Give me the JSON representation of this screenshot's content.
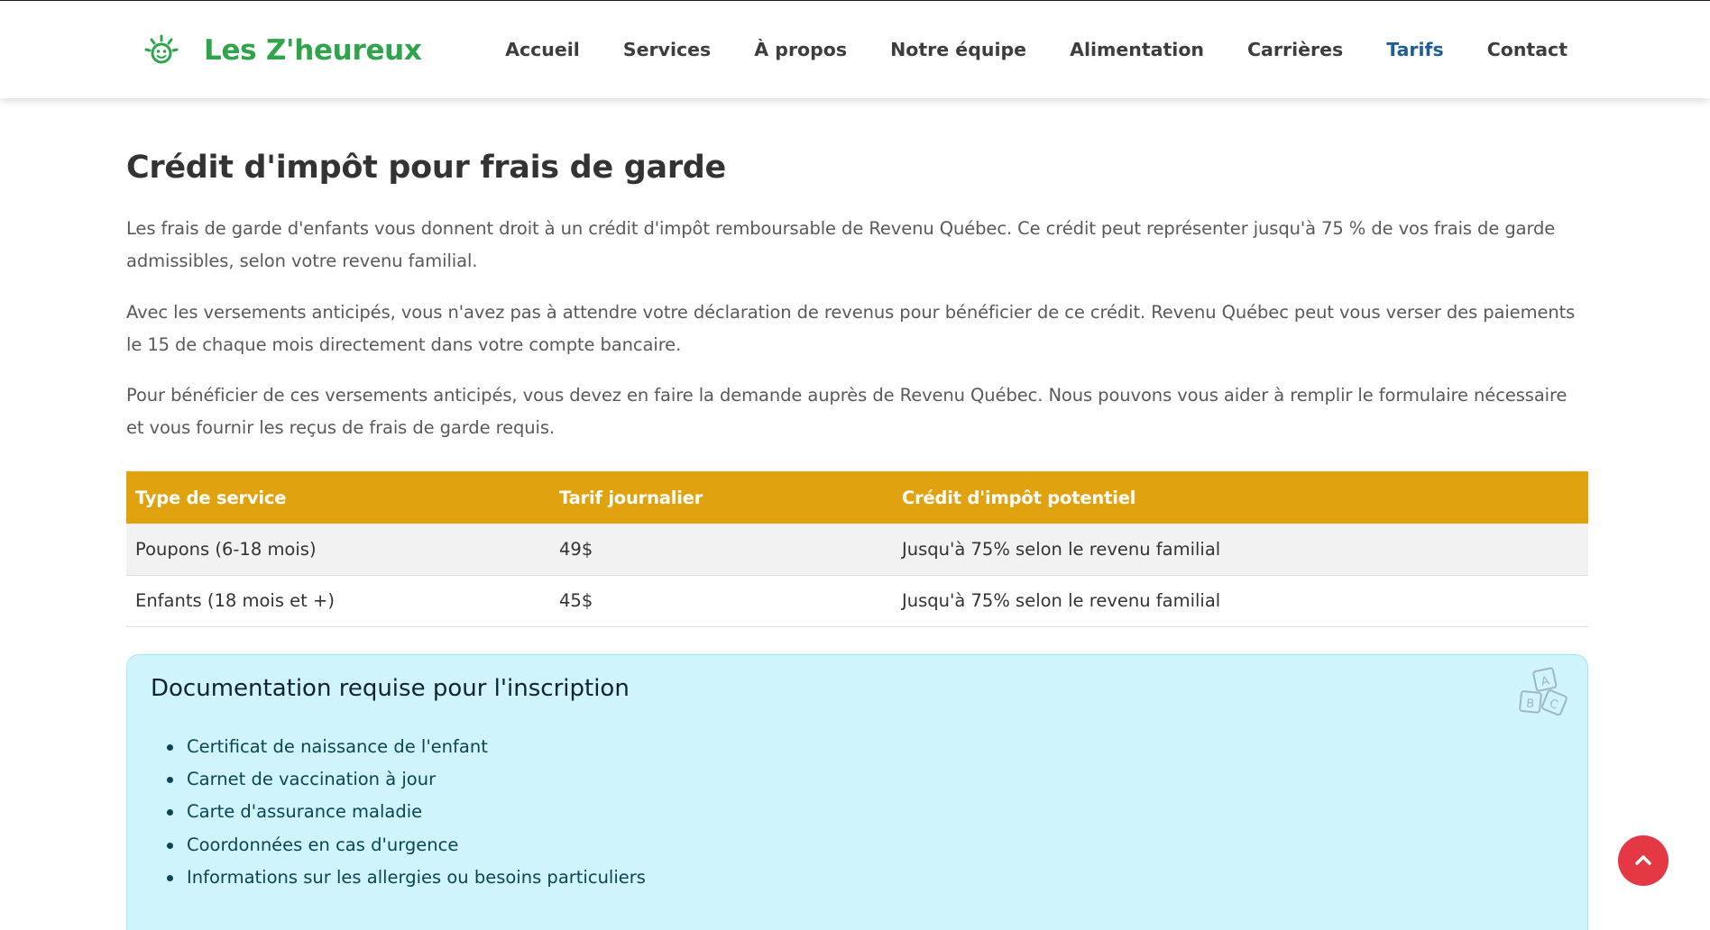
{
  "brand": {
    "name": "Les Z'heureux",
    "logo_icon": "smiling-sun-icon",
    "color": "#2fa44a"
  },
  "nav": {
    "items": [
      {
        "label": "Accueil",
        "active": false
      },
      {
        "label": "Services",
        "active": false
      },
      {
        "label": "À propos",
        "active": false
      },
      {
        "label": "Notre équipe",
        "active": false
      },
      {
        "label": "Alimentation",
        "active": false
      },
      {
        "label": "Carrières",
        "active": false
      },
      {
        "label": "Tarifs",
        "active": true
      },
      {
        "label": "Contact",
        "active": false
      }
    ],
    "active_color": "#1f5d95"
  },
  "section": {
    "title": "Crédit d'impôt pour frais de garde",
    "paragraphs": [
      "Les frais de garde d'enfants vous donnent droit à un crédit d'impôt remboursable de Revenu Québec. Ce crédit peut représenter jusqu'à 75 % de vos frais de garde admissibles, selon votre revenu familial.",
      "Avec les versements anticipés, vous n'avez pas à attendre votre déclaration de revenus pour bénéficier de ce crédit. Revenu Québec peut vous verser des paiements le 15 de chaque mois directement dans votre compte bancaire.",
      "Pour bénéficier de ces versements anticipés, vous devez en faire la demande auprès de Revenu Québec. Nous pouvons vous aider à remplir le formulaire nécessaire et vous fournir les reçus de frais de garde requis."
    ]
  },
  "table": {
    "headers": [
      "Type de service",
      "Tarif journalier",
      "Crédit d'impôt potentiel"
    ],
    "rows": [
      [
        "Poupons (6-18 mois)",
        "49$",
        "Jusqu'à 75% selon le revenu familial"
      ],
      [
        "Enfants (18 mois et +)",
        "45$",
        "Jusqu'à 75% selon le revenu familial"
      ]
    ],
    "header_color": "#e0a30f"
  },
  "documentation": {
    "title": "Documentation requise pour l'inscription",
    "icon": "abc-blocks-icon",
    "items": [
      "Certificat de naissance de l'enfant",
      "Carnet de vaccination à jour",
      "Carte d'assurance maladie",
      "Coordonnées en cas d'urgence",
      "Informations sur les allergies ou besoins particuliers"
    ],
    "block_letters": [
      "A",
      "B",
      "C"
    ],
    "background": "#cff4fc"
  },
  "scroll_top": {
    "icon": "chevron-up-icon",
    "color": "#e53845"
  }
}
